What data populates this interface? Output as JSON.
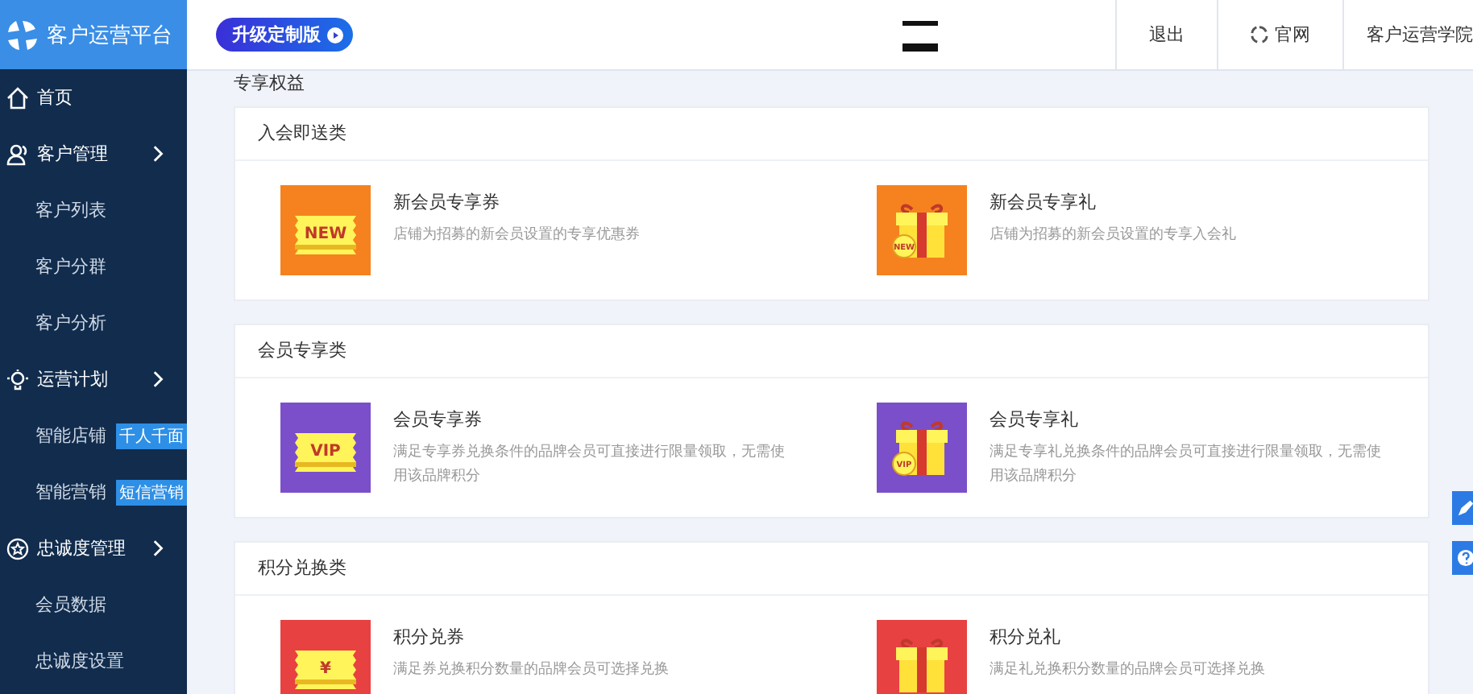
{
  "brand": {
    "title": "客户运营平台"
  },
  "header": {
    "upgrade": "升级定制版",
    "links": [
      {
        "label": "退出",
        "kind": "plain"
      },
      {
        "label": "官网",
        "kind": "globe"
      },
      {
        "label": "客户运营学院",
        "kind": "plain"
      }
    ]
  },
  "sidebar": {
    "items": [
      {
        "label": "首页",
        "kind": "home"
      },
      {
        "label": "客户管理",
        "kind": "users"
      },
      {
        "label": "客户列表",
        "kind": "sub"
      },
      {
        "label": "客户分群",
        "kind": "sub"
      },
      {
        "label": "客户分析",
        "kind": "sub"
      },
      {
        "label": "运营计划",
        "kind": "bulb"
      },
      {
        "label": "智能店铺",
        "kind": "sub",
        "badge": "千人千面"
      },
      {
        "label": "智能营销",
        "kind": "sub",
        "badge": "短信营销"
      },
      {
        "label": "忠诚度管理",
        "kind": "star"
      },
      {
        "label": "会员数据",
        "kind": "sub"
      },
      {
        "label": "忠诚度设置",
        "kind": "sub"
      }
    ]
  },
  "page_title": "专享权益",
  "sections": [
    {
      "title": "入会即送类",
      "items": [
        {
          "name": "新会员专享券",
          "desc": "店铺为招募的新会员设置的专享优惠券",
          "kind": "coupon",
          "color": "#f5821f",
          "badge": "NEW"
        },
        {
          "name": "新会员专享礼",
          "desc": "店铺为招募的新会员设置的专享入会礼",
          "kind": "gift",
          "color": "#f5821f",
          "badge": "NEW"
        }
      ]
    },
    {
      "title": "会员专享类",
      "items": [
        {
          "name": "会员专享券",
          "desc": "满足专享券兑换条件的品牌会员可直接进行限量领取，无需使用该品牌积分",
          "kind": "coupon",
          "color": "#7b4fc9",
          "badge": "VIP"
        },
        {
          "name": "会员专享礼",
          "desc": "满足专享礼兑换条件的品牌会员可直接进行限量领取，无需使用该品牌积分",
          "kind": "gift",
          "color": "#7b4fc9",
          "badge": "VIP"
        }
      ]
    },
    {
      "title": "积分兑换类",
      "items": [
        {
          "name": "积分兑券",
          "desc": "满足券兑换积分数量的品牌会员可选择兑换",
          "kind": "coupon",
          "color": "#e84141",
          "badge": "¥"
        },
        {
          "name": "积分兑礼",
          "desc": "满足礼兑换积分数量的品牌会员可选择兑换",
          "kind": "gift",
          "color": "#e84141"
        }
      ]
    }
  ]
}
